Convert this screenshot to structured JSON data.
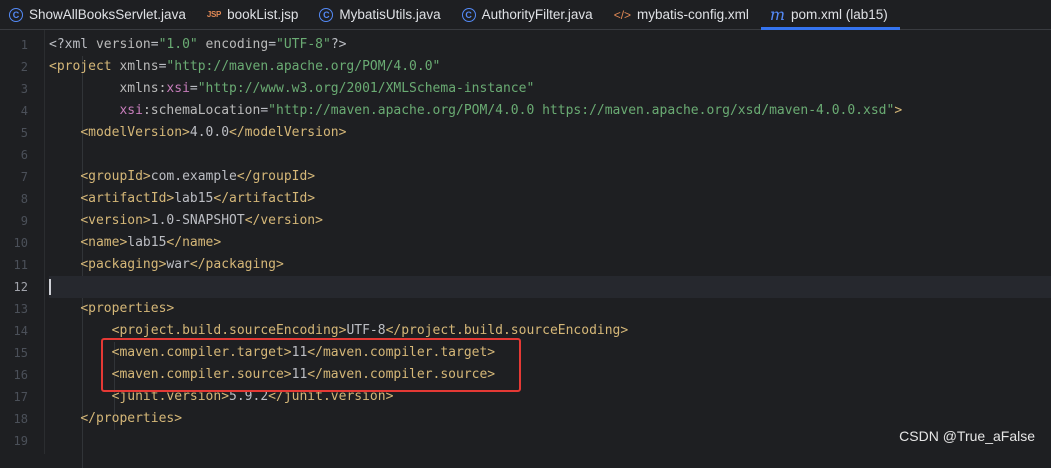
{
  "tabs": [
    {
      "label": "ShowAllBooksServlet.java",
      "icon": "java-class-icon",
      "active": false
    },
    {
      "label": "bookList.jsp",
      "icon": "jsp-file-icon",
      "active": false
    },
    {
      "label": "MybatisUtils.java",
      "icon": "java-class-icon",
      "active": false
    },
    {
      "label": "AuthorityFilter.java",
      "icon": "java-class-icon",
      "active": false
    },
    {
      "label": "mybatis-config.xml",
      "icon": "xml-file-icon",
      "active": false
    },
    {
      "label": "pom.xml (lab15)",
      "icon": "maven-file-icon",
      "active": true
    }
  ],
  "tab_icon_glyphs": {
    "c": "C",
    "jsp": "JSP",
    "xml": "</>",
    "m": "m"
  },
  "line_numbers": [
    "1",
    "2",
    "3",
    "4",
    "5",
    "6",
    "7",
    "8",
    "9",
    "10",
    "11",
    "12",
    "13",
    "14",
    "15",
    "16",
    "17",
    "18",
    "19"
  ],
  "current_line": "12",
  "code": {
    "l1": {
      "pi_open": "<?xml ",
      "v_attr": "version",
      "eq1": "=",
      "v_val": "\"1.0\"",
      "e_attr": " encoding",
      "eq2": "=",
      "e_val": "\"UTF-8\"",
      "pi_close": "?>"
    },
    "l2": {
      "open": "<project ",
      "attr": "xmlns",
      "eq": "=",
      "val": "\"http://maven.apache.org/POM/4.0.0\""
    },
    "l3": {
      "indent": "         ",
      "attr": "xmlns",
      "colon": ":",
      "ns": "xsi",
      "eq": "=",
      "val": "\"http://www.w3.org/2001/XMLSchema-instance\""
    },
    "l4": {
      "indent": "         ",
      "ns": "xsi",
      "colon": ":",
      "attr": "schemaLocation",
      "eq": "=",
      "val": "\"http://maven.apache.org/POM/4.0.0 https://maven.apache.org/xsd/maven-4.0.0.xsd\"",
      "close": ">"
    },
    "l5": {
      "indent": "    ",
      "open": "<modelVersion>",
      "text": "4.0.0",
      "close": "</modelVersion>"
    },
    "l7": {
      "indent": "    ",
      "open": "<groupId>",
      "text": "com.example",
      "close": "</groupId>"
    },
    "l8": {
      "indent": "    ",
      "open": "<artifactId>",
      "text": "lab15",
      "close": "</artifactId>"
    },
    "l9": {
      "indent": "    ",
      "open": "<version>",
      "text": "1.0-SNAPSHOT",
      "close": "</version>"
    },
    "l10": {
      "indent": "    ",
      "open": "<name>",
      "text": "lab15",
      "close": "</name>"
    },
    "l11": {
      "indent": "    ",
      "open": "<packaging>",
      "text": "war",
      "close": "</packaging>"
    },
    "l13": {
      "indent": "    ",
      "open": "<properties>"
    },
    "l14": {
      "indent": "        ",
      "open": "<project.build.sourceEncoding>",
      "text": "UTF-8",
      "close": "</project.build.sourceEncoding>"
    },
    "l15": {
      "indent": "        ",
      "open": "<maven.compiler.target>",
      "text": "11",
      "close": "</maven.compiler.target>"
    },
    "l16": {
      "indent": "        ",
      "open": "<maven.compiler.source>",
      "text": "11",
      "close": "</maven.compiler.source>"
    },
    "l17": {
      "indent": "        ",
      "open": "<junit.version>",
      "text": "5.9.2",
      "close": "</junit.version>"
    },
    "l18": {
      "indent": "    ",
      "close": "</properties>"
    }
  },
  "watermark": "CSDN @True_aFalse",
  "colors": {
    "highlight_box": "#e53935",
    "tag": "#d5b778",
    "string": "#6aab73",
    "namespace": "#c77dbb",
    "accent": "#3574f0"
  }
}
